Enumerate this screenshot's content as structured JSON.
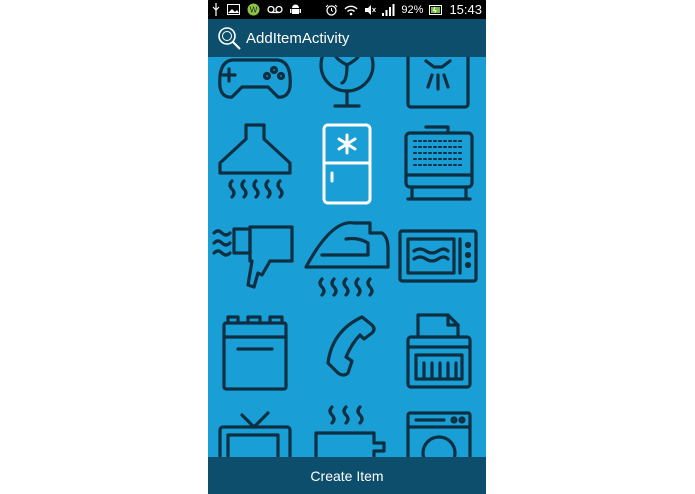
{
  "status_bar": {
    "battery_percent": "92%",
    "time": "15:43",
    "icons": [
      "usb-icon",
      "gallery-icon",
      "app-w-icon",
      "voicemail-icon",
      "android-icon",
      "alarm-icon",
      "wifi-icon",
      "mute-icon",
      "signal-icon",
      "battery-icon"
    ]
  },
  "action_bar": {
    "title": "AddItemActivity",
    "icon": "search-app-icon"
  },
  "grid": {
    "items": [
      {
        "icon": "gamepad-icon",
        "selected": false
      },
      {
        "icon": "fan-icon",
        "selected": false
      },
      {
        "icon": "shower-icon",
        "selected": false
      },
      {
        "icon": "range-hood-icon",
        "selected": false
      },
      {
        "icon": "fridge-icon",
        "selected": true
      },
      {
        "icon": "waffle-maker-icon",
        "selected": false
      },
      {
        "icon": "hair-dryer-icon",
        "selected": false
      },
      {
        "icon": "iron-icon",
        "selected": false
      },
      {
        "icon": "microwave-icon",
        "selected": false
      },
      {
        "icon": "oven-icon",
        "selected": false
      },
      {
        "icon": "phone-icon",
        "selected": false
      },
      {
        "icon": "fax-machine-icon",
        "selected": false
      },
      {
        "icon": "tv-icon",
        "selected": false
      },
      {
        "icon": "kettle-icon",
        "selected": false
      },
      {
        "icon": "washing-machine-icon",
        "selected": false
      }
    ]
  },
  "footer": {
    "create_label": "Create Item"
  },
  "colors": {
    "background": "#1a9ed6",
    "bar": "#0e4e6d",
    "icon_stroke": "#0d2f42",
    "selected_stroke": "#ffffff"
  }
}
